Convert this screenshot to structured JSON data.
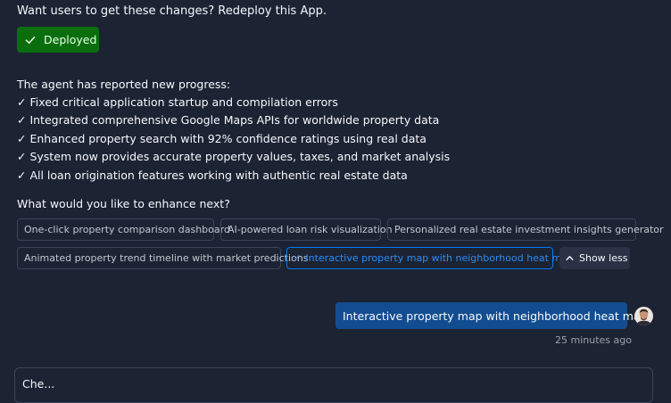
{
  "redeploy_prompt": "Want users to get these changes? Redeploy this App.",
  "deploy_button": {
    "label": "Deployed",
    "status_color": "#0b6e0e"
  },
  "progress": {
    "intro": "The agent has reported new progress:",
    "items": [
      "✓ Fixed critical application startup and compilation errors",
      "✓ Integrated comprehensive Google Maps APIs for worldwide property data",
      "✓ Enhanced property search with 92% confidence ratings using real data",
      "✓ System now provides accurate property values, taxes, and market analysis",
      "✓ All loan origination features working with authentic real estate data"
    ]
  },
  "suggestions": {
    "question": "What would you like to enhance next?",
    "chips": [
      {
        "label": "One-click property comparison dashboard",
        "selected": false
      },
      {
        "label": "AI-powered loan risk visualization",
        "selected": false
      },
      {
        "label": "Personalized real estate investment insights generator",
        "selected": false
      },
      {
        "label": "Animated property trend timeline with market predictions",
        "selected": false
      },
      {
        "label": "Interactive property map with neighborhood heat maps",
        "selected": true
      }
    ],
    "toggle_label": "Show less"
  },
  "user_message": {
    "text": "Interactive property map with neighborhood heat maps",
    "timestamp": "25 minutes ago"
  },
  "bottom_panel": {
    "peek_text": "Che..."
  },
  "colors": {
    "background": "#1c2333",
    "accent": "#0079f2",
    "user_bubble": "#134d91"
  },
  "icons": {
    "deployed": "check-icon",
    "selected_chip": "check-icon",
    "show_less": "chevron-up-icon",
    "avatar": "user-avatar"
  }
}
